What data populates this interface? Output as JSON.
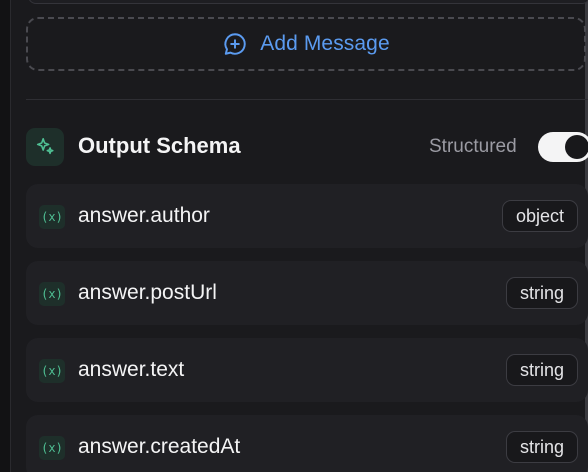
{
  "add_message": {
    "label": "Add Message",
    "icon": "message-plus-icon",
    "color": "#5b9bf0"
  },
  "output_schema": {
    "title": "Output Schema",
    "icon": "sparkle-icon",
    "structured_label": "Structured",
    "structured_enabled": true,
    "fields": [
      {
        "name": "answer.author",
        "type": "object",
        "icon": "variable-icon"
      },
      {
        "name": "answer.postUrl",
        "type": "string",
        "icon": "variable-icon"
      },
      {
        "name": "answer.text",
        "type": "string",
        "icon": "variable-icon"
      },
      {
        "name": "answer.createdAt",
        "type": "string",
        "icon": "variable-icon"
      }
    ]
  },
  "colors": {
    "background": "#1a1a1d",
    "row_background": "#202024",
    "accent_green": "#4fbf93"
  }
}
